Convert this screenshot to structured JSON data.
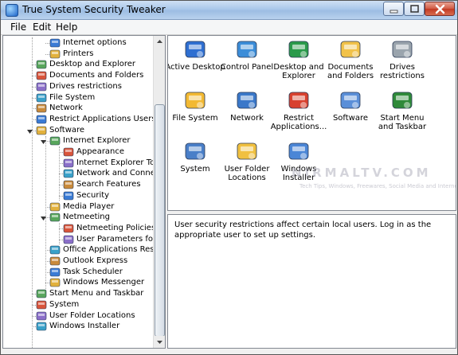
{
  "window": {
    "title": "True System Security Tweaker"
  },
  "menu": {
    "items": [
      "File",
      "Edit",
      "Help"
    ]
  },
  "tree": {
    "items": [
      {
        "label": "Internet options",
        "level": 2,
        "icon": "internet-options-icon"
      },
      {
        "label": "Printers",
        "level": 2,
        "icon": "printer-icon"
      },
      {
        "label": "Desktop and Explorer",
        "level": 1,
        "icon": "desktop-icon"
      },
      {
        "label": "Documents and Folders",
        "level": 1,
        "icon": "documents-icon"
      },
      {
        "label": "Drives restrictions",
        "level": 1,
        "icon": "drive-icon"
      },
      {
        "label": "File System",
        "level": 1,
        "icon": "file-system-icon"
      },
      {
        "label": "Network",
        "level": 1,
        "icon": "network-icon"
      },
      {
        "label": "Restrict Applications Users Can",
        "level": 1,
        "icon": "restrict-apps-icon"
      },
      {
        "label": "Software",
        "level": 1,
        "icon": "software-icon",
        "expanded": true
      },
      {
        "label": "Internet Explorer",
        "level": 2,
        "icon": "internet-explorer-icon",
        "expanded": true
      },
      {
        "label": "Appearance",
        "level": 3,
        "icon": "appearance-icon"
      },
      {
        "label": "Internet Explorer Toolb",
        "level": 3,
        "icon": "ie-toolbar-icon"
      },
      {
        "label": "Network and Connectic",
        "level": 3,
        "icon": "network-connections-icon"
      },
      {
        "label": "Search Features",
        "level": 3,
        "icon": "search-features-icon"
      },
      {
        "label": "Security",
        "level": 3,
        "icon": "security-icon"
      },
      {
        "label": "Media Player",
        "level": 2,
        "icon": "media-player-icon"
      },
      {
        "label": "Netmeeting",
        "level": 2,
        "icon": "netmeeting-icon",
        "expanded": true
      },
      {
        "label": "Netmeeting Policies and",
        "level": 3,
        "icon": "netmeeting-policies-icon"
      },
      {
        "label": "User Parameters for Ne",
        "level": 3,
        "icon": "user-parameters-icon"
      },
      {
        "label": "Office Applications Restrict",
        "level": 2,
        "icon": "office-icon"
      },
      {
        "label": "Outlook Express",
        "level": 2,
        "icon": "outlook-express-icon"
      },
      {
        "label": "Task Scheduler",
        "level": 2,
        "icon": "task-scheduler-icon"
      },
      {
        "label": "Windows Messenger",
        "level": 2,
        "icon": "messenger-icon"
      },
      {
        "label": "Start Menu and Taskbar",
        "level": 1,
        "icon": "start-menu-icon"
      },
      {
        "label": "System",
        "level": 1,
        "icon": "system-icon"
      },
      {
        "label": "User Folder Locations",
        "level": 1,
        "icon": "user-folder-icon"
      },
      {
        "label": "Windows Installer",
        "level": 1,
        "icon": "windows-installer-icon"
      }
    ]
  },
  "icons": [
    {
      "label": "Active Desktop",
      "icon": "active-desktop-icon",
      "color": "#2f6fd1"
    },
    {
      "label": "Control Panel",
      "icon": "control-panel-icon",
      "color": "#3c8dd8"
    },
    {
      "label": "Desktop and Explorer",
      "icon": "desktop-explorer-icon",
      "color": "#2a9a4a"
    },
    {
      "label": "Documents and Folders",
      "icon": "documents-folders-icon",
      "color": "#f1c24a"
    },
    {
      "label": "Drives restrictions",
      "icon": "drives-icon",
      "color": "#9aa4ad"
    },
    {
      "label": "File System",
      "icon": "file-system-big-icon",
      "color": "#f2b933"
    },
    {
      "label": "Network",
      "icon": "network-big-icon",
      "color": "#3b78c9"
    },
    {
      "label": "Restrict Applications...",
      "icon": "restrict-applications-icon",
      "color": "#d8412f"
    },
    {
      "label": "Software",
      "icon": "software-big-icon",
      "color": "#5b8fd8"
    },
    {
      "label": "Start Menu and Taskbar",
      "icon": "start-menu-taskbar-icon",
      "color": "#2f8a3a"
    },
    {
      "label": "System",
      "icon": "system-big-icon",
      "color": "#4a7fc8"
    },
    {
      "label": "User Folder Locations",
      "icon": "user-folder-locations-icon",
      "color": "#f0c040"
    },
    {
      "label": "Windows Installer",
      "icon": "windows-installer-big-icon",
      "color": "#4b86d6"
    }
  ],
  "watermark": {
    "text": "NIRMALTV.COM",
    "subtext": "Tech Tips, Windows, Freewares, Social Media and Internet"
  },
  "description": {
    "text": "User security restrictions affect certain local users. Log in as the appropriate user to set up settings."
  },
  "colors": {
    "titlebar": "#aac8ea",
    "close_button": "#c23a23",
    "tree_lines": "#a0a0a0"
  }
}
